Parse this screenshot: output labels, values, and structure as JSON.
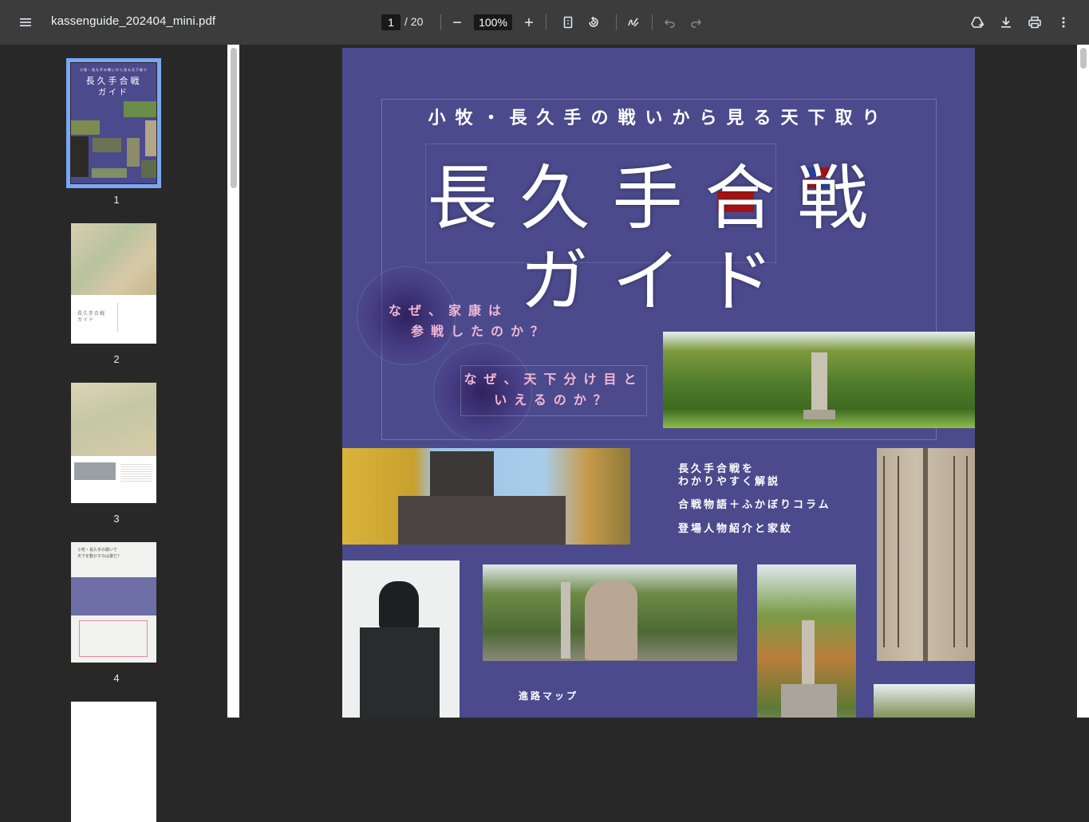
{
  "toolbar": {
    "title": "kassenguide_202404_mini.pdf",
    "current_page": "1",
    "page_total": "/ 20",
    "zoom": "100%",
    "icons": [
      "menu-icon",
      "minus-icon",
      "plus-icon",
      "fit-page-icon",
      "rotate-icon",
      "annotate-icon",
      "undo-icon",
      "redo-icon",
      "drive-add-icon",
      "download-icon",
      "print-icon",
      "more-vert-icon"
    ]
  },
  "sidebar": {
    "thumbnails": [
      {
        "label": "1"
      },
      {
        "label": "2"
      },
      {
        "label": "3"
      },
      {
        "label": "4"
      }
    ],
    "thumb1_title_line1": "長久手合戦",
    "thumb1_title_line2": "ガイド",
    "thumb1_subtitle": "小牧・長久手の戦いから見る天下取り",
    "thumb2_title_line1": "長久手合戦",
    "thumb2_title_line2": "ガイド",
    "thumb4_title_line1": "小牧・長久手の戦いで",
    "thumb4_title_line2": "天下を動かすのは誰だ？"
  },
  "page1": {
    "subtitle": "小牧・長久手の戦いから見る天下取り",
    "title_line1": "長久手合戦",
    "title_line2": "ガイド",
    "question1_line1": "なぜ、家康は",
    "question1_line2": "参戦したのか？",
    "question2_line1": "なぜ、天下分け目と",
    "question2_line2": "いえるのか？",
    "features": [
      {
        "line1": "長久手合戦を",
        "line2": "わかりやすく解説"
      },
      {
        "line1": "合戦物語＋ふかぼりコラム",
        "line2": ""
      },
      {
        "line1": "登場人物紹介と家紋",
        "line2": ""
      }
    ],
    "map_label": "進路マップ",
    "accent_color": "#a71414",
    "background_color": "#4b4a8c"
  }
}
